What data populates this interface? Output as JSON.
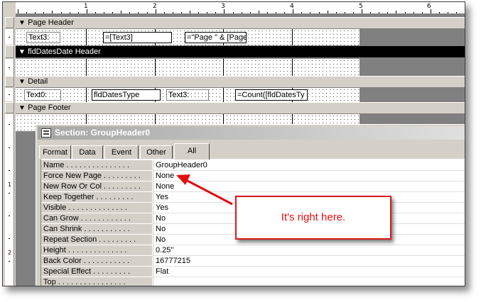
{
  "ruler": {
    "top_numbers": [
      "1",
      "2",
      "3",
      "4",
      "5",
      "6"
    ],
    "left_numbers": [
      "1",
      "2"
    ]
  },
  "sections": {
    "page_header": "Page Header",
    "group_header": "fldDatesDate Header",
    "detail": "Detail",
    "page_footer": "Page Footer"
  },
  "controls": {
    "header_label": "Text3:",
    "header_text": "=[Text3]",
    "header_page": "=\"Page \" & [Page]",
    "detail_label": "Text0:",
    "detail_type": "fldDatesType",
    "detail_text3": "Text3:",
    "detail_count": "=Count([fldDatesTy"
  },
  "property_sheet": {
    "title": "Section: GroupHeader0",
    "tabs": [
      "Format",
      "Data",
      "Event",
      "Other",
      "All"
    ],
    "active_tab": "All",
    "properties": [
      {
        "name": "Name . . . . . . . . . . . . . . .",
        "value": "GroupHeader0"
      },
      {
        "name": "Force New Page . . . . . . . . .",
        "value": "None"
      },
      {
        "name": "New Row Or Col . . . . . . . . .",
        "value": "None"
      },
      {
        "name": "Keep Together . . . . . . . . .",
        "value": "Yes"
      },
      {
        "name": "Visible . . . . . . . . . . . . . .",
        "value": "Yes"
      },
      {
        "name": "Can Grow . . . . . . . . . . . .",
        "value": "No"
      },
      {
        "name": "Can Shrink . . . . . . . . . . .",
        "value": "No"
      },
      {
        "name": "Repeat Section . . . . . . . . .",
        "value": "No"
      },
      {
        "name": "Height . . . . . . . . . . . . . .",
        "value": "0.25\""
      },
      {
        "name": "Back Color . . . . . . . . . . .",
        "value": "16777215"
      },
      {
        "name": "Special Effect . . . . . . . . .",
        "value": "Flat"
      },
      {
        "name": "Top . . . . . . . . . . . . . . . .",
        "value": ""
      }
    ]
  },
  "annotation": {
    "text": "It's right here.",
    "color": "#e01010"
  }
}
